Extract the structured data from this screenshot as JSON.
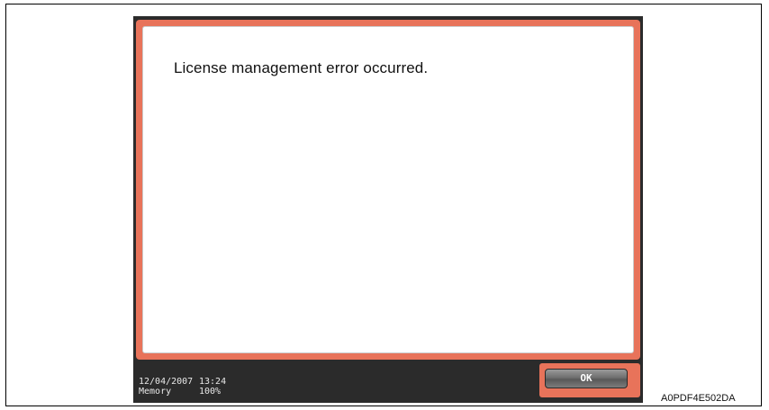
{
  "dialog": {
    "message": "License management error occurred."
  },
  "status_bar": {
    "date": "12/04/2007",
    "time": "13:24",
    "memory_label": "Memory",
    "memory_value": "100%"
  },
  "ok_button": {
    "label": "OK"
  },
  "figure_code": "A0PDF4E502DA",
  "colors": {
    "dialog_border": "#e8735a",
    "panel_background": "#2b2b2b",
    "dialog_background": "#ffffff"
  }
}
